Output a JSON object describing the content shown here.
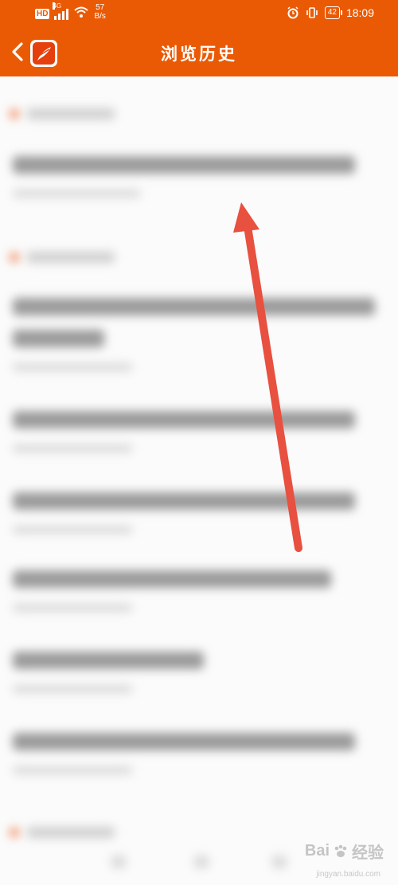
{
  "status_bar": {
    "network_badge": "HD",
    "network_type": "4G",
    "speed_value": "57",
    "speed_unit": "B/s",
    "battery": "42",
    "time": "18:09"
  },
  "app_bar": {
    "title": "浏览历史",
    "back_icon": "chevron-left-icon",
    "logo_icon": "app-logo-icon"
  },
  "watermark": {
    "brand": "Bai",
    "brand_suffix": "经验",
    "url": "jingyan.baidu.com"
  },
  "colors": {
    "accent": "#ea5a05",
    "annotation_arrow": "#e8503f"
  }
}
